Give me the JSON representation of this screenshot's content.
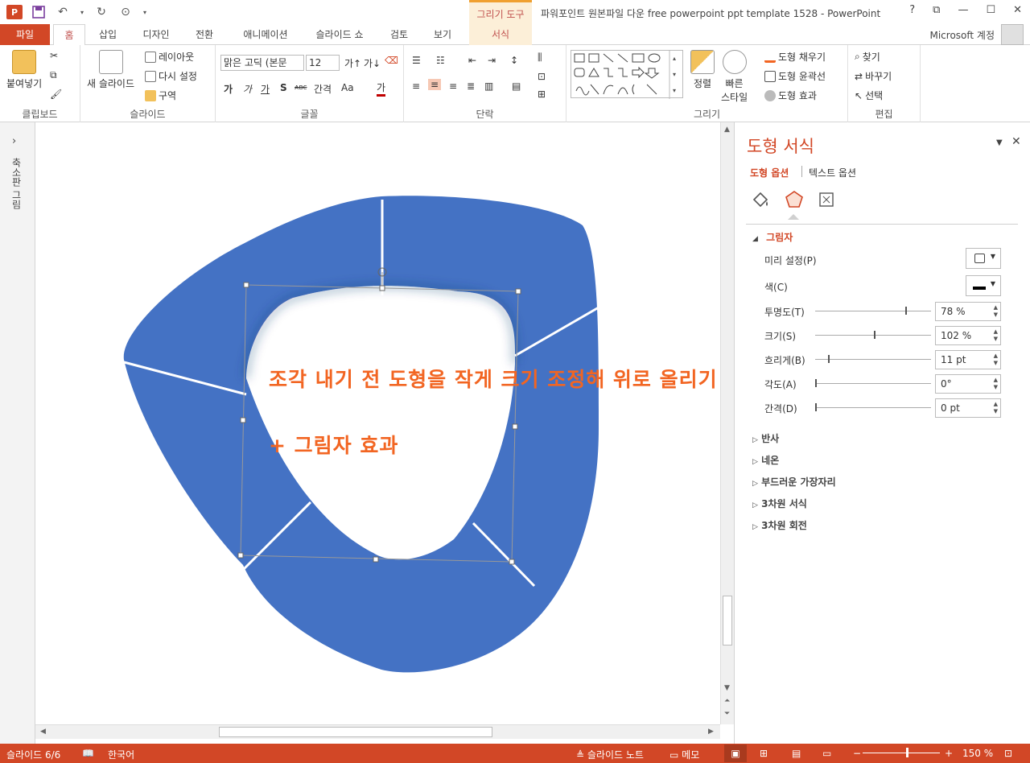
{
  "window": {
    "title": "파워포인트 원본파일 다운 free powerpoint ppt template 1528 - PowerPoint",
    "context_tab_group": "그리기 도구",
    "account": "Microsoft 계정",
    "help": "?",
    "app_logo": "P"
  },
  "tabs": [
    "파일",
    "홈",
    "삽입",
    "디자인",
    "전환",
    "애니메이션",
    "슬라이드 쇼",
    "검토",
    "보기",
    "서식"
  ],
  "ribbon": {
    "clipboard": {
      "label": "클립보드",
      "paste": "붙여넣기"
    },
    "slides": {
      "label": "슬라이드",
      "new_slide": "새 슬라이드",
      "layout": "레이아웃",
      "reset": "다시 설정",
      "section": "구역"
    },
    "font": {
      "label": "글꼴",
      "family": "맑은 고딕 (본문",
      "size": "12",
      "b": "가",
      "i": "가",
      "u": "가",
      "s": "S",
      "strike": "ᴀʙᴄ",
      "spacing": "간격",
      "case": "Aa",
      "color": "가"
    },
    "paragraph": {
      "label": "단락"
    },
    "drawing": {
      "label": "그리기",
      "arrange": "정렬",
      "quick_styles": "빠른\n스타일",
      "fill": "도형 채우기",
      "outline": "도형 윤곽선",
      "effects": "도형 효과"
    },
    "editing": {
      "label": "편집",
      "find": "찾기",
      "replace": "바꾸기",
      "select": "선택"
    }
  },
  "left_pane": {
    "label": "축소판 그림",
    "expand": "›"
  },
  "slide_text": {
    "line1": "조각 내기 전 도형을 작게 크기 조정해 위로 올리기",
    "line2": "+ 그림자 효과"
  },
  "colors": {
    "shape_fill": "#4472c4",
    "accent": "#d24726",
    "overlay_text": "#f26522"
  },
  "format_pane": {
    "title": "도형 서식",
    "tab_shape": "도형 옵션",
    "tab_text": "텍스트 옵션",
    "icons": [
      "fill-line-icon",
      "effects-icon",
      "size-properties-icon"
    ],
    "shadow": {
      "header": "그림자",
      "preset_label": "미리 설정(P)",
      "color_label": "색(C)",
      "transparency_label": "투명도(T)",
      "transparency": "78 %",
      "transparency_value": 78,
      "size_label": "크기(S)",
      "size": "102 %",
      "size_value": 102,
      "blur_label": "흐리게(B)",
      "blur": "11 pt",
      "blur_value": 11,
      "angle_label": "각도(A)",
      "angle": "0°",
      "distance_label": "간격(D)",
      "distance": "0 pt"
    },
    "sections": [
      "반사",
      "네온",
      "부드러운 가장자리",
      "3차원 서식",
      "3차원 회전"
    ]
  },
  "status": {
    "slide": "슬라이드 6/6",
    "language": "한국어",
    "notes": "슬라이드 노트",
    "comments": "메모",
    "zoom": "150 %"
  }
}
